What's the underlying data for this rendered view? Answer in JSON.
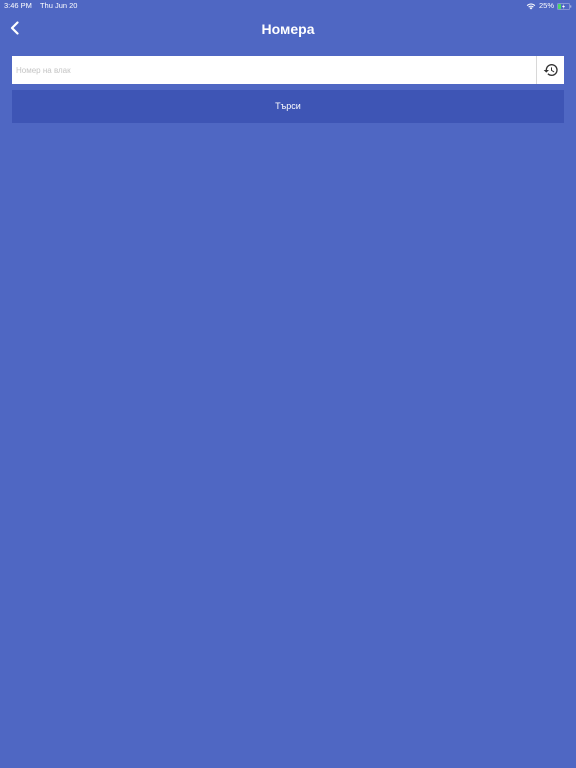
{
  "status_bar": {
    "time": "3:46 PM",
    "date": "Thu Jun 20",
    "battery": "25%",
    "icons": [
      "wifi-icon",
      "battery-charging-icon"
    ]
  },
  "nav": {
    "back_icon": "chevron-left-icon",
    "title": "Номера"
  },
  "search": {
    "placeholder": "Номер на влак",
    "value": "",
    "history_icon": "history-icon"
  },
  "actions": {
    "search_label": "Търси"
  },
  "colors": {
    "background": "#4F67C3",
    "button": "#3E55B5",
    "input_background": "#FFFFFF",
    "text": "#FFFFFF"
  }
}
